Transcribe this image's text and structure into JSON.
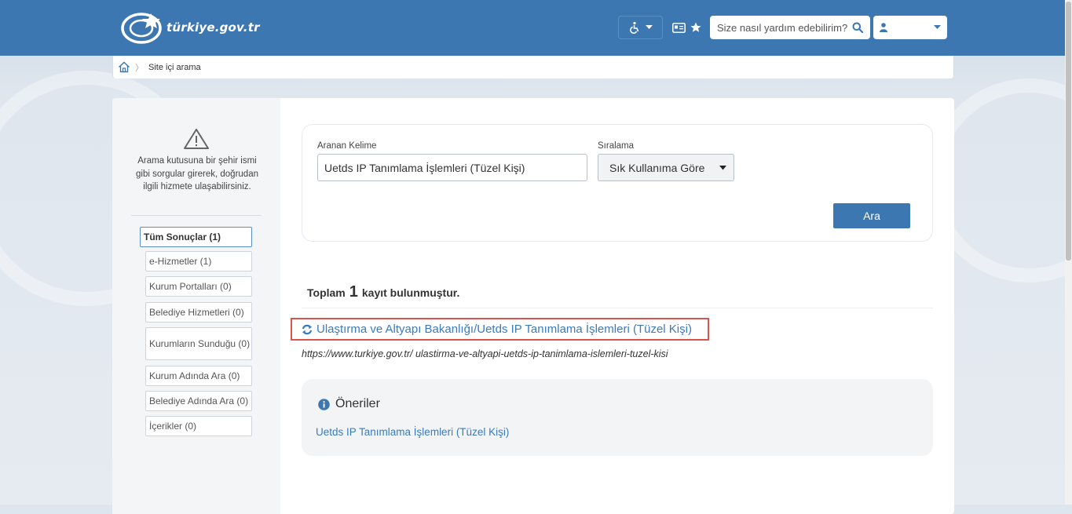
{
  "header": {
    "logo_text": "türkiye.gov.tr",
    "search_placeholder": "Size nasıl yardım edebilirim?",
    "user_name": "",
    "icons": {
      "accessibility": "wheelchair-icon",
      "id_card": "id-card-icon",
      "favorite": "star-icon",
      "search": "search-icon",
      "user": "user-icon"
    }
  },
  "breadcrumb": {
    "home_icon": "home-icon",
    "current": "Site içi arama"
  },
  "sidebar": {
    "tip": "Arama kutusuna bir şehir ismi gibi sorgular girerek, doğrudan ilgili hizmete ulaşabilirsiniz.",
    "filters": [
      "Tüm Sonuçlar (1)",
      "e-Hizmetler (1)",
      "Kurum Portalları (0)",
      "Belediye Hizmetleri (0)",
      "Kurumların Sunduğu (0)",
      "Kurum Adında Ara (0)",
      "Belediye Adında Ara (0)",
      "İçerikler (0)"
    ]
  },
  "search_form": {
    "keyword_label": "Aranan Kelime",
    "keyword_value": "Uetds IP Tanımlama İşlemleri (Tüzel Kişi)",
    "sort_label": "Sıralama",
    "sort_value": "Sık Kullanıma Göre",
    "submit_label": "Ara"
  },
  "results": {
    "total_prefix": "Toplam",
    "total_count": "1",
    "total_suffix": "kayıt bulunmuştur.",
    "items": [
      {
        "title": "Ulaştırma ve Altyapı Bakanlığı/Uetds IP Tanımlama İşlemleri (Tüzel Kişi)",
        "url": "https://www.turkiye.gov.tr/ ulastirma-ve-altyapi-uetds-ip-tanimlama-islemleri-tuzel-kisi"
      }
    ]
  },
  "suggestions": {
    "title": "Öneriler",
    "items": [
      "Uetds IP Tanımlama İşlemleri (Tüzel Kişi)"
    ]
  },
  "colors": {
    "brand_blue": "#3d77b1",
    "link_blue": "#3a7bbf",
    "highlight_red": "#d9534f"
  }
}
